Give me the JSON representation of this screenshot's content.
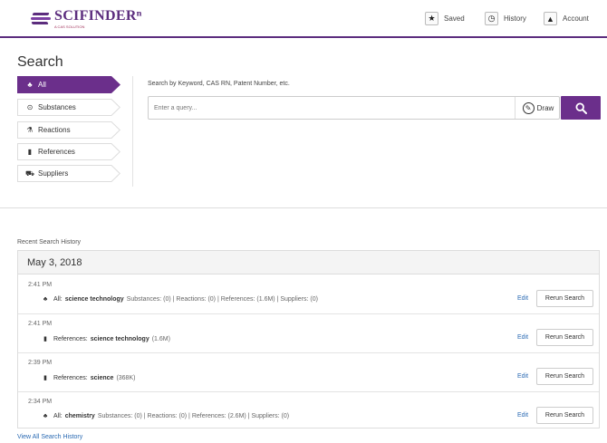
{
  "brand": {
    "name": "SCIFINDERⁿ",
    "tagline": "A CAS SOLUTION",
    "accent": "#6b2f8b"
  },
  "topnav": {
    "saved_label": "Saved",
    "history_label": "History",
    "account_label": "Account",
    "saved_icon": "★",
    "history_icon": "◷",
    "account_icon": "▲"
  },
  "search": {
    "title": "Search",
    "hint": "Search by Keyword, CAS RN, Patent Number, etc.",
    "placeholder": "Enter a query...",
    "draw_label": "Draw",
    "categories": [
      {
        "label": "All",
        "icon": "♣",
        "active": true
      },
      {
        "label": "Substances",
        "icon": "⊙",
        "active": false
      },
      {
        "label": "Reactions",
        "icon": "⚗",
        "active": false
      },
      {
        "label": "References",
        "icon": "▮",
        "active": false
      },
      {
        "label": "Suppliers",
        "icon": "⛟",
        "active": false
      }
    ]
  },
  "history": {
    "section_label": "Recent Search History",
    "date": "May 3, 2018",
    "edit_label": "Edit",
    "rerun_label": "Rerun Search",
    "view_all": "View All Search History",
    "rows": [
      {
        "time": "2:41 PM",
        "icon": "♣",
        "type": "All:",
        "term": "science technology",
        "detail": "Substances: (0) | Reactions: (0) | References: (1.6M) | Suppliers: (0)"
      },
      {
        "time": "2:41 PM",
        "icon": "▮",
        "type": "References:",
        "term": "science technology",
        "detail": "(1.6M)"
      },
      {
        "time": "2:39 PM",
        "icon": "▮",
        "type": "References:",
        "term": "science",
        "detail": "(368K)"
      },
      {
        "time": "2:34 PM",
        "icon": "♣",
        "type": "All:",
        "term": "chemistry",
        "detail": "Substances: (0) | Reactions: (0) | References: (2.6M) | Suppliers: (0)"
      }
    ]
  }
}
